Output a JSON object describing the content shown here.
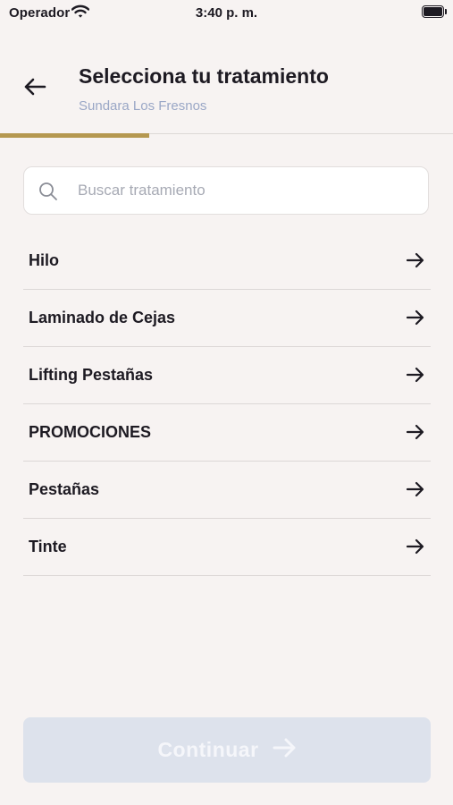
{
  "status_bar": {
    "carrier": "Operador",
    "time": "3:40 p. m."
  },
  "header": {
    "title": "Selecciona tu tratamiento",
    "subtitle": "Sundara Los Fresnos"
  },
  "progress": {
    "fraction": 0.33,
    "color": "#b59850"
  },
  "search": {
    "placeholder": "Buscar tratamiento",
    "value": ""
  },
  "categories": [
    {
      "label": "Hilo"
    },
    {
      "label": "Laminado de Cejas"
    },
    {
      "label": "Lifting Pestañas"
    },
    {
      "label": "PROMOCIONES"
    },
    {
      "label": "Pestañas"
    },
    {
      "label": "Tinte"
    }
  ],
  "footer": {
    "continue_label": "Continuar",
    "enabled": false
  },
  "icons": {
    "back": "arrow-left-icon",
    "search": "search-icon",
    "row_arrow": "arrow-right-icon",
    "continue_arrow": "arrow-right-icon"
  },
  "colors": {
    "background": "#f7f3f2",
    "accent": "#b59850",
    "subtitle": "#9aa7c6",
    "button_disabled_bg": "#dde2ec"
  }
}
